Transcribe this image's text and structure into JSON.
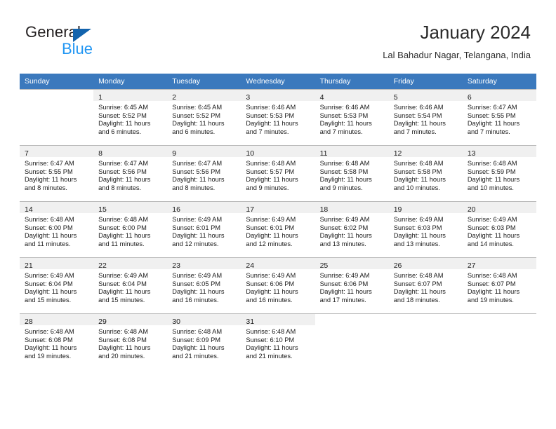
{
  "brand": {
    "name_part1": "General",
    "name_part2": "Blue",
    "logo_icon": "triangle-logo-icon",
    "accent_dark": "#1263ad",
    "accent_light": "#2196f3"
  },
  "header": {
    "month_title": "January 2024",
    "location": "Lal Bahadur Nagar, Telangana, India"
  },
  "calendar": {
    "header_bg": "#3b79bd",
    "header_text_color": "#ffffff",
    "daynum_bg": "#f0f0f0",
    "weekdays": [
      "Sunday",
      "Monday",
      "Tuesday",
      "Wednesday",
      "Thursday",
      "Friday",
      "Saturday"
    ],
    "weeks": [
      [
        {
          "day": "",
          "sunrise": "",
          "sunset": "",
          "daylight1": "",
          "daylight2": ""
        },
        {
          "day": "1",
          "sunrise": "Sunrise: 6:45 AM",
          "sunset": "Sunset: 5:52 PM",
          "daylight1": "Daylight: 11 hours",
          "daylight2": "and 6 minutes."
        },
        {
          "day": "2",
          "sunrise": "Sunrise: 6:45 AM",
          "sunset": "Sunset: 5:52 PM",
          "daylight1": "Daylight: 11 hours",
          "daylight2": "and 6 minutes."
        },
        {
          "day": "3",
          "sunrise": "Sunrise: 6:46 AM",
          "sunset": "Sunset: 5:53 PM",
          "daylight1": "Daylight: 11 hours",
          "daylight2": "and 7 minutes."
        },
        {
          "day": "4",
          "sunrise": "Sunrise: 6:46 AM",
          "sunset": "Sunset: 5:53 PM",
          "daylight1": "Daylight: 11 hours",
          "daylight2": "and 7 minutes."
        },
        {
          "day": "5",
          "sunrise": "Sunrise: 6:46 AM",
          "sunset": "Sunset: 5:54 PM",
          "daylight1": "Daylight: 11 hours",
          "daylight2": "and 7 minutes."
        },
        {
          "day": "6",
          "sunrise": "Sunrise: 6:47 AM",
          "sunset": "Sunset: 5:55 PM",
          "daylight1": "Daylight: 11 hours",
          "daylight2": "and 7 minutes."
        }
      ],
      [
        {
          "day": "7",
          "sunrise": "Sunrise: 6:47 AM",
          "sunset": "Sunset: 5:55 PM",
          "daylight1": "Daylight: 11 hours",
          "daylight2": "and 8 minutes."
        },
        {
          "day": "8",
          "sunrise": "Sunrise: 6:47 AM",
          "sunset": "Sunset: 5:56 PM",
          "daylight1": "Daylight: 11 hours",
          "daylight2": "and 8 minutes."
        },
        {
          "day": "9",
          "sunrise": "Sunrise: 6:47 AM",
          "sunset": "Sunset: 5:56 PM",
          "daylight1": "Daylight: 11 hours",
          "daylight2": "and 8 minutes."
        },
        {
          "day": "10",
          "sunrise": "Sunrise: 6:48 AM",
          "sunset": "Sunset: 5:57 PM",
          "daylight1": "Daylight: 11 hours",
          "daylight2": "and 9 minutes."
        },
        {
          "day": "11",
          "sunrise": "Sunrise: 6:48 AM",
          "sunset": "Sunset: 5:58 PM",
          "daylight1": "Daylight: 11 hours",
          "daylight2": "and 9 minutes."
        },
        {
          "day": "12",
          "sunrise": "Sunrise: 6:48 AM",
          "sunset": "Sunset: 5:58 PM",
          "daylight1": "Daylight: 11 hours",
          "daylight2": "and 10 minutes."
        },
        {
          "day": "13",
          "sunrise": "Sunrise: 6:48 AM",
          "sunset": "Sunset: 5:59 PM",
          "daylight1": "Daylight: 11 hours",
          "daylight2": "and 10 minutes."
        }
      ],
      [
        {
          "day": "14",
          "sunrise": "Sunrise: 6:48 AM",
          "sunset": "Sunset: 6:00 PM",
          "daylight1": "Daylight: 11 hours",
          "daylight2": "and 11 minutes."
        },
        {
          "day": "15",
          "sunrise": "Sunrise: 6:48 AM",
          "sunset": "Sunset: 6:00 PM",
          "daylight1": "Daylight: 11 hours",
          "daylight2": "and 11 minutes."
        },
        {
          "day": "16",
          "sunrise": "Sunrise: 6:49 AM",
          "sunset": "Sunset: 6:01 PM",
          "daylight1": "Daylight: 11 hours",
          "daylight2": "and 12 minutes."
        },
        {
          "day": "17",
          "sunrise": "Sunrise: 6:49 AM",
          "sunset": "Sunset: 6:01 PM",
          "daylight1": "Daylight: 11 hours",
          "daylight2": "and 12 minutes."
        },
        {
          "day": "18",
          "sunrise": "Sunrise: 6:49 AM",
          "sunset": "Sunset: 6:02 PM",
          "daylight1": "Daylight: 11 hours",
          "daylight2": "and 13 minutes."
        },
        {
          "day": "19",
          "sunrise": "Sunrise: 6:49 AM",
          "sunset": "Sunset: 6:03 PM",
          "daylight1": "Daylight: 11 hours",
          "daylight2": "and 13 minutes."
        },
        {
          "day": "20",
          "sunrise": "Sunrise: 6:49 AM",
          "sunset": "Sunset: 6:03 PM",
          "daylight1": "Daylight: 11 hours",
          "daylight2": "and 14 minutes."
        }
      ],
      [
        {
          "day": "21",
          "sunrise": "Sunrise: 6:49 AM",
          "sunset": "Sunset: 6:04 PM",
          "daylight1": "Daylight: 11 hours",
          "daylight2": "and 15 minutes."
        },
        {
          "day": "22",
          "sunrise": "Sunrise: 6:49 AM",
          "sunset": "Sunset: 6:04 PM",
          "daylight1": "Daylight: 11 hours",
          "daylight2": "and 15 minutes."
        },
        {
          "day": "23",
          "sunrise": "Sunrise: 6:49 AM",
          "sunset": "Sunset: 6:05 PM",
          "daylight1": "Daylight: 11 hours",
          "daylight2": "and 16 minutes."
        },
        {
          "day": "24",
          "sunrise": "Sunrise: 6:49 AM",
          "sunset": "Sunset: 6:06 PM",
          "daylight1": "Daylight: 11 hours",
          "daylight2": "and 16 minutes."
        },
        {
          "day": "25",
          "sunrise": "Sunrise: 6:49 AM",
          "sunset": "Sunset: 6:06 PM",
          "daylight1": "Daylight: 11 hours",
          "daylight2": "and 17 minutes."
        },
        {
          "day": "26",
          "sunrise": "Sunrise: 6:48 AM",
          "sunset": "Sunset: 6:07 PM",
          "daylight1": "Daylight: 11 hours",
          "daylight2": "and 18 minutes."
        },
        {
          "day": "27",
          "sunrise": "Sunrise: 6:48 AM",
          "sunset": "Sunset: 6:07 PM",
          "daylight1": "Daylight: 11 hours",
          "daylight2": "and 19 minutes."
        }
      ],
      [
        {
          "day": "28",
          "sunrise": "Sunrise: 6:48 AM",
          "sunset": "Sunset: 6:08 PM",
          "daylight1": "Daylight: 11 hours",
          "daylight2": "and 19 minutes."
        },
        {
          "day": "29",
          "sunrise": "Sunrise: 6:48 AM",
          "sunset": "Sunset: 6:08 PM",
          "daylight1": "Daylight: 11 hours",
          "daylight2": "and 20 minutes."
        },
        {
          "day": "30",
          "sunrise": "Sunrise: 6:48 AM",
          "sunset": "Sunset: 6:09 PM",
          "daylight1": "Daylight: 11 hours",
          "daylight2": "and 21 minutes."
        },
        {
          "day": "31",
          "sunrise": "Sunrise: 6:48 AM",
          "sunset": "Sunset: 6:10 PM",
          "daylight1": "Daylight: 11 hours",
          "daylight2": "and 21 minutes."
        },
        {
          "day": "",
          "sunrise": "",
          "sunset": "",
          "daylight1": "",
          "daylight2": ""
        },
        {
          "day": "",
          "sunrise": "",
          "sunset": "",
          "daylight1": "",
          "daylight2": ""
        },
        {
          "day": "",
          "sunrise": "",
          "sunset": "",
          "daylight1": "",
          "daylight2": ""
        }
      ]
    ]
  }
}
